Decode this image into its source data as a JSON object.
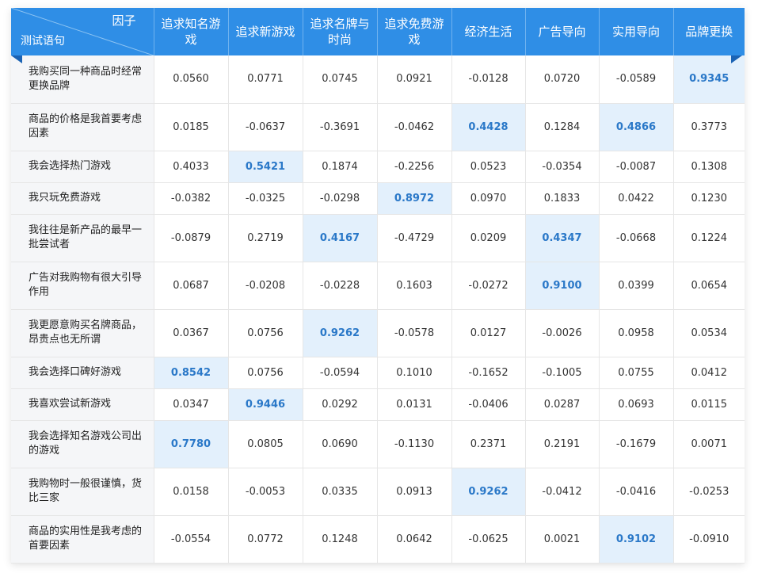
{
  "header": {
    "corner_top": "因子",
    "corner_bottom": "测试语句",
    "columns": [
      "追求知名游戏",
      "追求新游戏",
      "追求名牌与时尚",
      "追求免费游戏",
      "经济生活",
      "广告导向",
      "实用导向",
      "品牌更换"
    ]
  },
  "rows": [
    {
      "label": "我购买同一种商品时经常更换品牌",
      "values": [
        "0.0560",
        "0.0771",
        "0.0745",
        "0.0921",
        "-0.0128",
        "0.0720",
        "-0.0589",
        "0.9345"
      ],
      "highlight": [
        7
      ]
    },
    {
      "label": "商品的价格是我首要考虑因素",
      "values": [
        "0.0185",
        "-0.0637",
        "-0.3691",
        "-0.0462",
        "0.4428",
        "0.1284",
        "0.4866",
        "0.3773"
      ],
      "highlight": [
        4,
        6
      ]
    },
    {
      "label": "我会选择热门游戏",
      "values": [
        "0.4033",
        "0.5421",
        "0.1874",
        "-0.2256",
        "0.0523",
        "-0.0354",
        "-0.0087",
        "0.1308"
      ],
      "highlight": [
        1
      ]
    },
    {
      "label": "我只玩免费游戏",
      "values": [
        "-0.0382",
        "-0.0325",
        "-0.0298",
        "0.8972",
        "0.0970",
        "0.1833",
        "0.0422",
        "0.1230"
      ],
      "highlight": [
        3
      ]
    },
    {
      "label": "我往往是新产品的最早一批尝试者",
      "values": [
        "-0.0879",
        "0.2719",
        "0.4167",
        "-0.4729",
        "0.0209",
        "0.4347",
        "-0.0668",
        "0.1224"
      ],
      "highlight": [
        2,
        5
      ]
    },
    {
      "label": "广告对我购物有很大引导作用",
      "values": [
        "0.0687",
        "-0.0208",
        "-0.0228",
        "0.1603",
        "-0.0272",
        "0.9100",
        "0.0399",
        "0.0654"
      ],
      "highlight": [
        5
      ]
    },
    {
      "label": "我更愿意购买名牌商品，昂贵点也无所谓",
      "values": [
        "0.0367",
        "0.0756",
        "0.9262",
        "-0.0578",
        "0.0127",
        "-0.0026",
        "0.0958",
        "0.0534"
      ],
      "highlight": [
        2
      ]
    },
    {
      "label": "我会选择口碑好游戏",
      "values": [
        "0.8542",
        "0.0756",
        "-0.0594",
        "0.1010",
        "-0.1652",
        "-0.1005",
        "0.0755",
        "0.0412"
      ],
      "highlight": [
        0
      ]
    },
    {
      "label": "我喜欢尝试新游戏",
      "values": [
        "0.0347",
        "0.9446",
        "0.0292",
        "0.0131",
        "-0.0406",
        "0.0287",
        "0.0693",
        "0.0115"
      ],
      "highlight": [
        1
      ]
    },
    {
      "label": "我会选择知名游戏公司出的游戏",
      "values": [
        "0.7780",
        "0.0805",
        "0.0690",
        "-0.1130",
        "0.2371",
        "0.2191",
        "-0.1679",
        "0.0071"
      ],
      "highlight": [
        0
      ]
    },
    {
      "label": "我购物时一般很谨慎，货比三家",
      "values": [
        "0.0158",
        "-0.0053",
        "0.0335",
        "0.0913",
        "0.9262",
        "-0.0412",
        "-0.0416",
        "-0.0253"
      ],
      "highlight": [
        4
      ]
    },
    {
      "label": "商品的实用性是我考虑的首要因素",
      "values": [
        "-0.0554",
        "0.0772",
        "0.1248",
        "0.0642",
        "-0.0625",
        "0.0021",
        "0.9102",
        "-0.0910"
      ],
      "highlight": [
        6
      ]
    }
  ],
  "colors": {
    "header_bg": "#2f8ee6",
    "highlight_bg": "#e3f0fc",
    "highlight_text": "#2a78c8",
    "label_bg": "#f5f6f8"
  }
}
